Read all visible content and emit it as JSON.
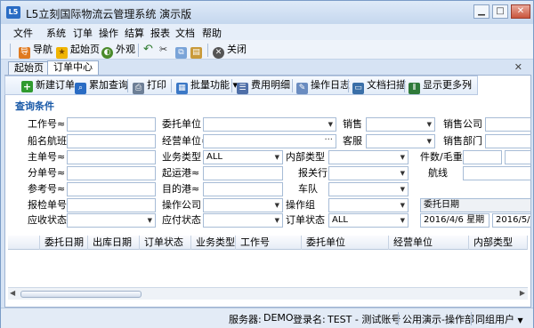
{
  "window": {
    "title": "L5立刻国际物流云管理系统 演示版",
    "app_icon": "L5"
  },
  "menu": [
    "文件",
    "系统",
    "订单",
    "操作",
    "结算",
    "报表",
    "文档",
    "帮助"
  ],
  "toolbar1": {
    "nav": "导航",
    "start_page": "起始页",
    "appearance": "外观",
    "close": "关闭"
  },
  "tabs": [
    "起始页",
    "订单中心"
  ],
  "toolbar2": {
    "new_order": "新建订单",
    "add_query": "累加查询",
    "print": "打印",
    "batch": "批量功能",
    "fee_detail": "费用明细",
    "op_log": "操作日志",
    "doc_scan": "文档扫描",
    "show_more_cols": "显示更多列"
  },
  "query": {
    "title": "查询条件",
    "labels": {
      "work_no": "工作号≈",
      "ship_voyage": "船名航班≈",
      "master_no": "主单号≈",
      "sub_no": "分单号≈",
      "ref_no": "参考号≈",
      "customs_no": "报检单号≈",
      "ar_status": "应收状态",
      "client": "委托单位",
      "operator_unit": "经营单位≈",
      "biz_type": "业务类型",
      "origin_port": "起运港≈",
      "dest_port": "目的港≈",
      "op_company": "操作公司",
      "ap_status": "应付状态",
      "sales": "销售",
      "customer_service": "客服",
      "internal_type": "内部类型",
      "declare_bank": "报关行",
      "fleet": "车队",
      "op_group": "操作组",
      "order_status": "订单状态",
      "sales_company": "销售公司",
      "sales_dept": "销售部门",
      "pieces_weight": "件数/毛重",
      "route": "航线"
    },
    "values": {
      "biz_type": "ALL",
      "order_status": "ALL",
      "date_type": "委托日期",
      "date_from": "2016/4/6 星期",
      "date_to": "2016/5/"
    }
  },
  "grid": {
    "columns": [
      "委托日期",
      "出库日期",
      "订单状态",
      "业务类型",
      "工作号",
      "委托单位",
      "经营单位",
      "内部类型"
    ]
  },
  "status": {
    "server_label": "服务器:",
    "server": "DEMO",
    "login_label": "登录名:",
    "login": "TEST - 测试账号",
    "dept": "公用演示-操作部",
    "group": "同组用户"
  },
  "colors": {
    "accent": "#1a5aa8",
    "window_bg": "#d6e3f4"
  }
}
